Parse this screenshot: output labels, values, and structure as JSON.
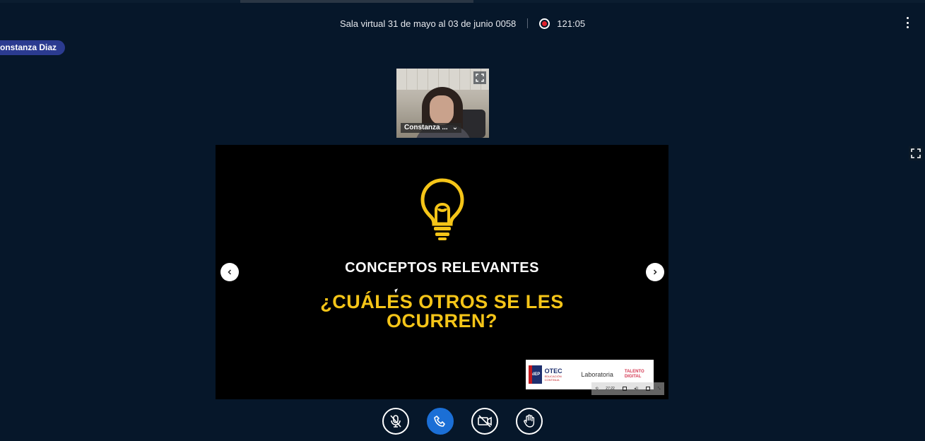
{
  "header": {
    "room_title": "Sala virtual 31 de mayo al 03 de junio 0058",
    "recording_time": "121:05"
  },
  "presenter": {
    "name": "onstanza Diaz"
  },
  "webcam": {
    "name": "Constanza ..."
  },
  "slide": {
    "heading": "CONCEPTOS RELEVANTES",
    "question": "¿CUÁLES OTROS SE LES OCURREN?",
    "logos": {
      "otec": "OTEC",
      "otec_sub": "EDUCACIÓN CONTINUA",
      "aiep": "AIEP",
      "laboratoria": "Laboratoria",
      "talento": "TALENTO DIGITAL"
    },
    "mini_toolbar_time": "27:22"
  },
  "icons": {
    "more": "kebab-menu-icon",
    "record": "record-icon",
    "expand": "expand-icon",
    "prev": "chevron-left-icon",
    "next": "chevron-right-icon",
    "mic": "mic-muted-icon",
    "hangup": "phone-icon",
    "camera": "camera-off-icon",
    "hand": "raise-hand-icon",
    "bulb": "lightbulb-icon"
  },
  "colors": {
    "background": "#06172a",
    "accent_blue": "#1b6fd6",
    "badge": "#2b3b90",
    "recording_red": "#e0212b",
    "slide_yellow": "#f5c518"
  }
}
